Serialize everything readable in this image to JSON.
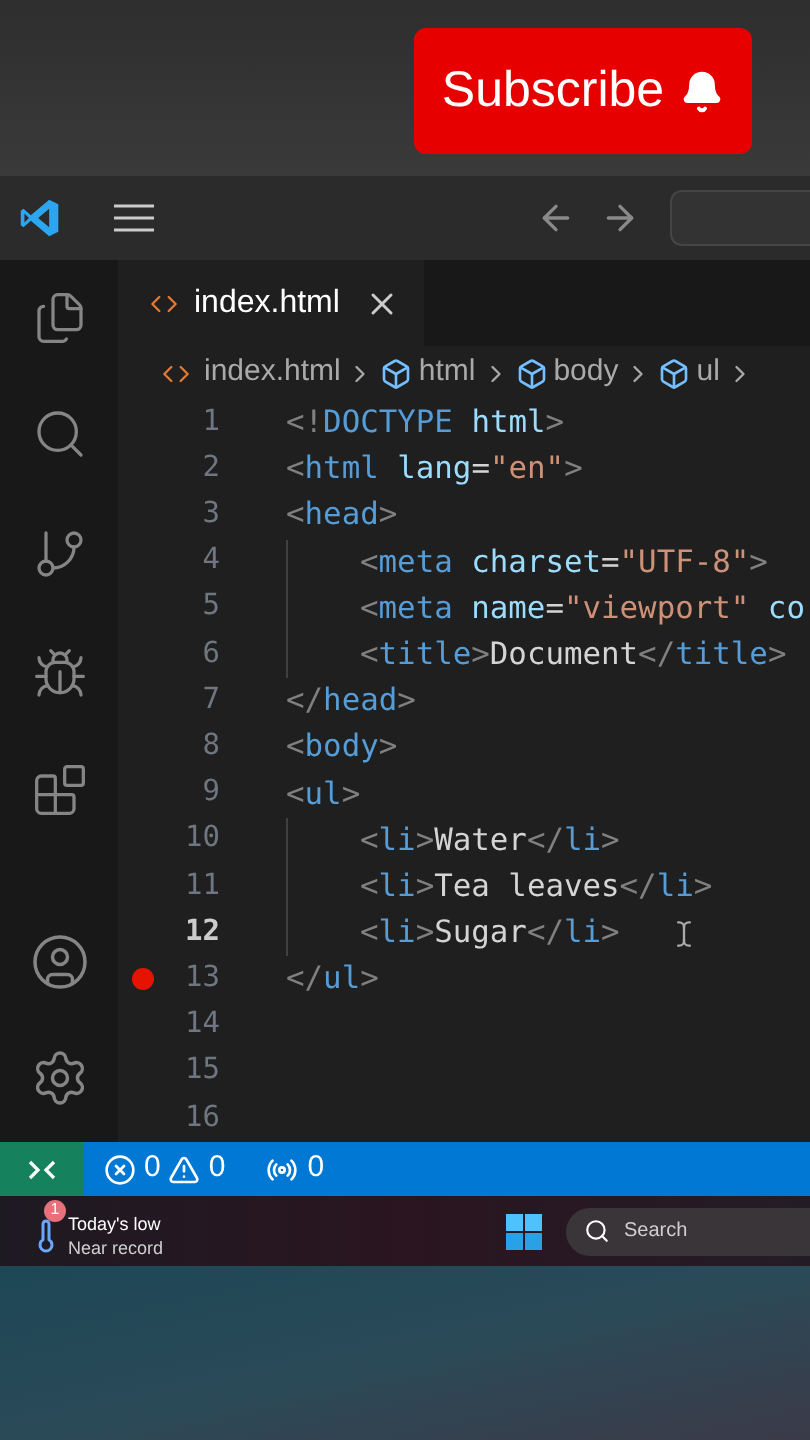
{
  "overlay": {
    "subscribe_button": "Subscribe"
  },
  "tabs": [
    {
      "label": "index.html",
      "selected": true
    }
  ],
  "breadcrumbs": [
    {
      "label": "index.html",
      "kind": "file"
    },
    {
      "label": "html",
      "kind": "element"
    },
    {
      "label": "body",
      "kind": "element"
    },
    {
      "label": "ul",
      "kind": "element"
    }
  ],
  "editor": {
    "lines": [
      {
        "number": "1",
        "current": false,
        "breakpoint": false,
        "indented": false,
        "tokens": [
          {
            "text": "<!",
            "kind": "punct"
          },
          {
            "text": "DOCTYPE",
            "kind": "tag"
          },
          {
            "text": " html",
            "kind": "attr"
          },
          {
            "text": ">",
            "kind": "punct"
          }
        ]
      },
      {
        "number": "2",
        "current": false,
        "breakpoint": false,
        "indented": false,
        "tokens": [
          {
            "text": "<",
            "kind": "punct"
          },
          {
            "text": "html",
            "kind": "tag"
          },
          {
            "text": " lang",
            "kind": "attr"
          },
          {
            "text": "=",
            "kind": "text"
          },
          {
            "text": "\"en\"",
            "kind": "string"
          },
          {
            "text": ">",
            "kind": "punct"
          }
        ]
      },
      {
        "number": "3",
        "current": false,
        "breakpoint": false,
        "indented": false,
        "tokens": [
          {
            "text": "<",
            "kind": "punct"
          },
          {
            "text": "head",
            "kind": "tag"
          },
          {
            "text": ">",
            "kind": "punct"
          }
        ]
      },
      {
        "number": "4",
        "current": false,
        "breakpoint": false,
        "indented": true,
        "tokens": [
          {
            "text": "<",
            "kind": "punct"
          },
          {
            "text": "meta",
            "kind": "tag"
          },
          {
            "text": " charset",
            "kind": "attr"
          },
          {
            "text": "=",
            "kind": "text"
          },
          {
            "text": "\"UTF-8\"",
            "kind": "string"
          },
          {
            "text": ">",
            "kind": "punct"
          }
        ]
      },
      {
        "number": "5",
        "current": false,
        "breakpoint": false,
        "indented": true,
        "tokens": [
          {
            "text": "<",
            "kind": "punct"
          },
          {
            "text": "meta",
            "kind": "tag"
          },
          {
            "text": " name",
            "kind": "attr"
          },
          {
            "text": "=",
            "kind": "text"
          },
          {
            "text": "\"viewport\"",
            "kind": "string"
          },
          {
            "text": " co",
            "kind": "attr"
          }
        ]
      },
      {
        "number": "6",
        "current": false,
        "breakpoint": false,
        "indented": true,
        "tokens": [
          {
            "text": "<",
            "kind": "punct"
          },
          {
            "text": "title",
            "kind": "tag"
          },
          {
            "text": ">",
            "kind": "punct"
          },
          {
            "text": "Document",
            "kind": "text"
          },
          {
            "text": "</",
            "kind": "punct"
          },
          {
            "text": "title",
            "kind": "tag"
          },
          {
            "text": ">",
            "kind": "punct"
          }
        ]
      },
      {
        "number": "7",
        "current": false,
        "breakpoint": false,
        "indented": false,
        "tokens": [
          {
            "text": "</",
            "kind": "punct"
          },
          {
            "text": "head",
            "kind": "tag"
          },
          {
            "text": ">",
            "kind": "punct"
          }
        ]
      },
      {
        "number": "8",
        "current": false,
        "breakpoint": false,
        "indented": false,
        "tokens": [
          {
            "text": "<",
            "kind": "punct"
          },
          {
            "text": "body",
            "kind": "tag"
          },
          {
            "text": ">",
            "kind": "punct"
          }
        ]
      },
      {
        "number": "9",
        "current": false,
        "breakpoint": false,
        "indented": false,
        "tokens": [
          {
            "text": "<",
            "kind": "punct"
          },
          {
            "text": "ul",
            "kind": "tag"
          },
          {
            "text": ">",
            "kind": "punct"
          }
        ]
      },
      {
        "number": "10",
        "current": false,
        "breakpoint": false,
        "indented": true,
        "tokens": [
          {
            "text": "<",
            "kind": "punct"
          },
          {
            "text": "li",
            "kind": "tag"
          },
          {
            "text": ">",
            "kind": "punct"
          },
          {
            "text": "Water",
            "kind": "text"
          },
          {
            "text": "</",
            "kind": "punct"
          },
          {
            "text": "li",
            "kind": "tag"
          },
          {
            "text": ">",
            "kind": "punct"
          }
        ]
      },
      {
        "number": "11",
        "current": false,
        "breakpoint": false,
        "indented": true,
        "tokens": [
          {
            "text": "<",
            "kind": "punct"
          },
          {
            "text": "li",
            "kind": "tag"
          },
          {
            "text": ">",
            "kind": "punct"
          },
          {
            "text": "Tea leaves",
            "kind": "text"
          },
          {
            "text": "</",
            "kind": "punct"
          },
          {
            "text": "li",
            "kind": "tag"
          },
          {
            "text": ">",
            "kind": "punct"
          }
        ]
      },
      {
        "number": "12",
        "current": true,
        "breakpoint": false,
        "indented": true,
        "tokens": [
          {
            "text": "<",
            "kind": "punct"
          },
          {
            "text": "li",
            "kind": "tag"
          },
          {
            "text": ">",
            "kind": "punct"
          },
          {
            "text": "Sugar",
            "kind": "text"
          },
          {
            "text": "</",
            "kind": "punct"
          },
          {
            "text": "li",
            "kind": "tag"
          },
          {
            "text": ">",
            "kind": "punct"
          }
        ]
      },
      {
        "number": "13",
        "current": false,
        "breakpoint": true,
        "indented": false,
        "tokens": [
          {
            "text": "</",
            "kind": "punct"
          },
          {
            "text": "ul",
            "kind": "tag"
          },
          {
            "text": ">",
            "kind": "punct"
          }
        ]
      },
      {
        "number": "14",
        "current": false,
        "breakpoint": false,
        "indented": false
      },
      {
        "number": "15",
        "current": false,
        "breakpoint": false,
        "indented": false
      },
      {
        "number": "16",
        "current": false,
        "breakpoint": false,
        "indented": false
      }
    ]
  },
  "status_bar": {
    "errors": "0",
    "warnings": "0",
    "ports": "0"
  },
  "taskbar": {
    "weather_badge": "1",
    "weather_title": "Today's low",
    "weather_subtitle": "Near record",
    "search": {
      "placeholder": "Search"
    }
  }
}
